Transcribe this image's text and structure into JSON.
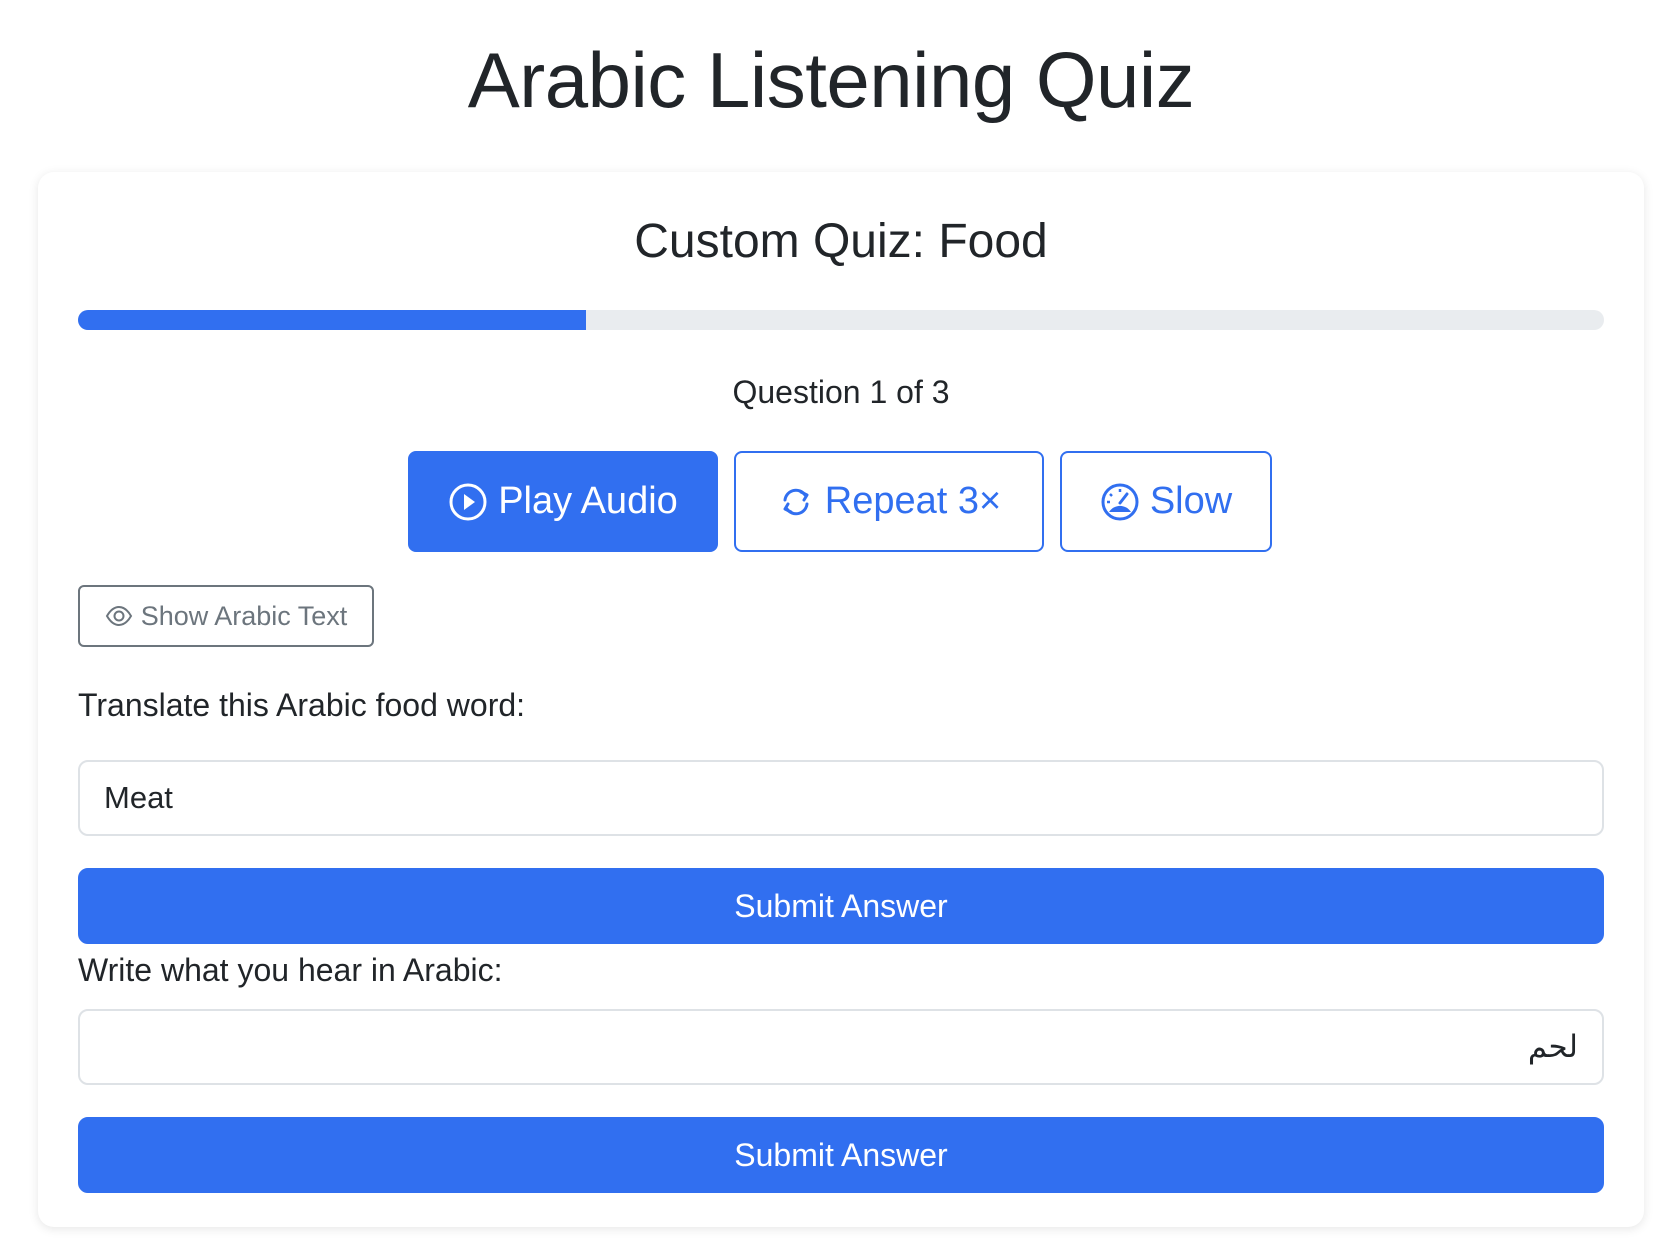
{
  "page": {
    "title": "Arabic Listening Quiz"
  },
  "quiz": {
    "title": "Custom Quiz: Food",
    "progress_fraction": 0.333,
    "question_counter": "Question 1 of 3"
  },
  "audio_controls": {
    "play": {
      "label": "Play Audio",
      "icon": "play-circle-icon"
    },
    "repeat": {
      "label": "Repeat 3×",
      "icon": "refresh-icon"
    },
    "slow": {
      "label": "Slow",
      "icon": "speedometer-icon"
    }
  },
  "show_text_button": {
    "label": "Show Arabic Text",
    "icon": "eye-icon"
  },
  "translate_section": {
    "label": "Translate this Arabic food word:",
    "value": "Meat",
    "submit_label": "Submit Answer"
  },
  "write_section": {
    "label": "Write what you hear in Arabic:",
    "value": "لحم",
    "submit_label": "Submit Answer"
  },
  "colors": {
    "primary": "#316ff0",
    "secondary": "#6c757d",
    "text": "#212529",
    "progress_track": "#e9ecef"
  }
}
